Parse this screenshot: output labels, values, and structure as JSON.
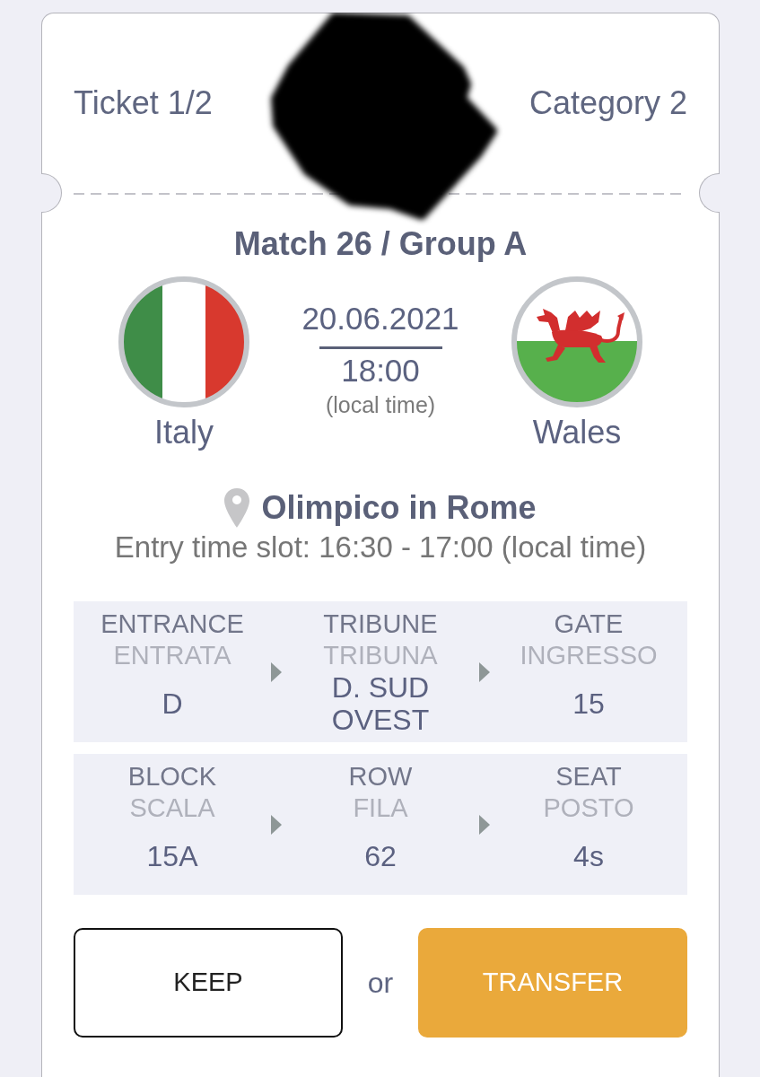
{
  "header": {
    "ticket": "Ticket 1/2",
    "category": "Category 2"
  },
  "match": {
    "title": "Match 26 / Group A",
    "teams": [
      {
        "name": "Italy",
        "kind": "tricolor"
      },
      {
        "name": "Wales",
        "kind": "dragon"
      }
    ],
    "date": "20.06.2021",
    "time": "18:00",
    "time_note": "(local time)"
  },
  "venue": {
    "name": "Olimpico in Rome",
    "entry_slot": "Entry time slot: 16:30 - 17:00 (local time)"
  },
  "seat_panels": [
    {
      "fields": [
        {
          "label": "ENTRANCE",
          "label_local": "ENTRATA",
          "value": "D"
        },
        {
          "label": "TRIBUNE",
          "label_local": "TRIBUNA",
          "value": "D. SUD OVEST"
        },
        {
          "label": "GATE",
          "label_local": "INGRESSO",
          "value": "15"
        }
      ]
    },
    {
      "fields": [
        {
          "label": "BLOCK",
          "label_local": "SCALA",
          "value": "15A"
        },
        {
          "label": "ROW",
          "label_local": "FILA",
          "value": "62"
        },
        {
          "label": "SEAT",
          "label_local": "POSTO",
          "value": "4s"
        }
      ]
    }
  ],
  "actions": {
    "buttons": [
      {
        "label": "KEEP",
        "kind": "outline"
      },
      {
        "label": "TRANSFER",
        "kind": "filled"
      }
    ],
    "separator": "or"
  }
}
